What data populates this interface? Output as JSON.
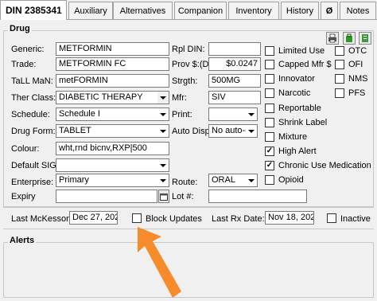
{
  "tabs": [
    {
      "label": "DIN 2385341"
    },
    {
      "label": "Auxiliary"
    },
    {
      "label": "Alternatives"
    },
    {
      "label": "Companion"
    },
    {
      "label": "Inventory"
    },
    {
      "label": "History"
    },
    {
      "label": "Ø",
      "icon": "paperclip-icon"
    },
    {
      "label": "Notes"
    }
  ],
  "drug_group": {
    "title": "Drug",
    "generic": {
      "label": "Generic:",
      "value": "METFORMIN"
    },
    "trade": {
      "label": "Trade:",
      "value": "METFORMIN FC"
    },
    "tall_man": {
      "label": "TaLL MaN:",
      "value": "metFORMIN"
    },
    "ther_class": {
      "label": "Ther Class:",
      "value": "DIABETIC THERAPY"
    },
    "schedule": {
      "label": "Schedule:",
      "value": "Schedule I"
    },
    "drug_form": {
      "label": "Drug Form:",
      "value": "TABLET"
    },
    "colour": {
      "label": "Colour:",
      "value": "wht,rnd bicnv,RXP|500"
    },
    "default_sig": {
      "label": "Default SIG",
      "value": ""
    },
    "enterprise": {
      "label": "Enterprise:",
      "value": "Primary"
    },
    "expiry": {
      "label": "Expiry",
      "value": ""
    },
    "rpl_din": {
      "label": "Rpl DIN:",
      "value": ""
    },
    "prov": {
      "label": "Prov $:(D)",
      "value": "$0.0247"
    },
    "strgth": {
      "label": "Strgth:",
      "value": "500MG"
    },
    "mfr": {
      "label": "Mfr:",
      "value": "SIV"
    },
    "print": {
      "label": "Print:",
      "value": ""
    },
    "auto_disp": {
      "label": "Auto Disp:",
      "value": "No auto-c"
    },
    "route": {
      "label": "Route:",
      "value": "ORAL"
    },
    "lot": {
      "label": "Lot #:",
      "value": ""
    }
  },
  "checkboxes": {
    "limited_use": {
      "label": "Limited Use",
      "checked": false
    },
    "capped_mfr": {
      "label": "Capped Mfr $",
      "checked": false
    },
    "innovator": {
      "label": "Innovator",
      "checked": false
    },
    "narcotic": {
      "label": "Narcotic",
      "checked": false
    },
    "reportable": {
      "label": "Reportable",
      "checked": false
    },
    "shrink_label": {
      "label": "Shrink Label",
      "checked": false
    },
    "mixture": {
      "label": "Mixture",
      "checked": false
    },
    "high_alert": {
      "label": "High Alert",
      "checked": true
    },
    "chronic_use": {
      "label": "Chronic Use Medication",
      "checked": true
    },
    "opioid": {
      "label": "Opioid",
      "checked": false
    },
    "otc": {
      "label": "OTC",
      "checked": false
    },
    "ofi": {
      "label": "OFI",
      "checked": false
    },
    "nms": {
      "label": "NMS",
      "checked": false
    },
    "pfs": {
      "label": "PFS",
      "checked": false
    }
  },
  "bottom": {
    "last_mckesson": {
      "label": "Last McKesson:",
      "value": "Dec 27, 2022"
    },
    "block_updates": {
      "label": "Block Updates",
      "checked": false
    },
    "last_rx_date": {
      "label": "Last Rx Date:",
      "value": "Nov 18, 2022"
    },
    "inactive": {
      "label": "Inactive",
      "checked": false
    }
  },
  "alerts_group": {
    "title": "Alerts"
  },
  "colors": {
    "arrow": "#f58b2b",
    "window_bg": "#f0f0f0"
  }
}
